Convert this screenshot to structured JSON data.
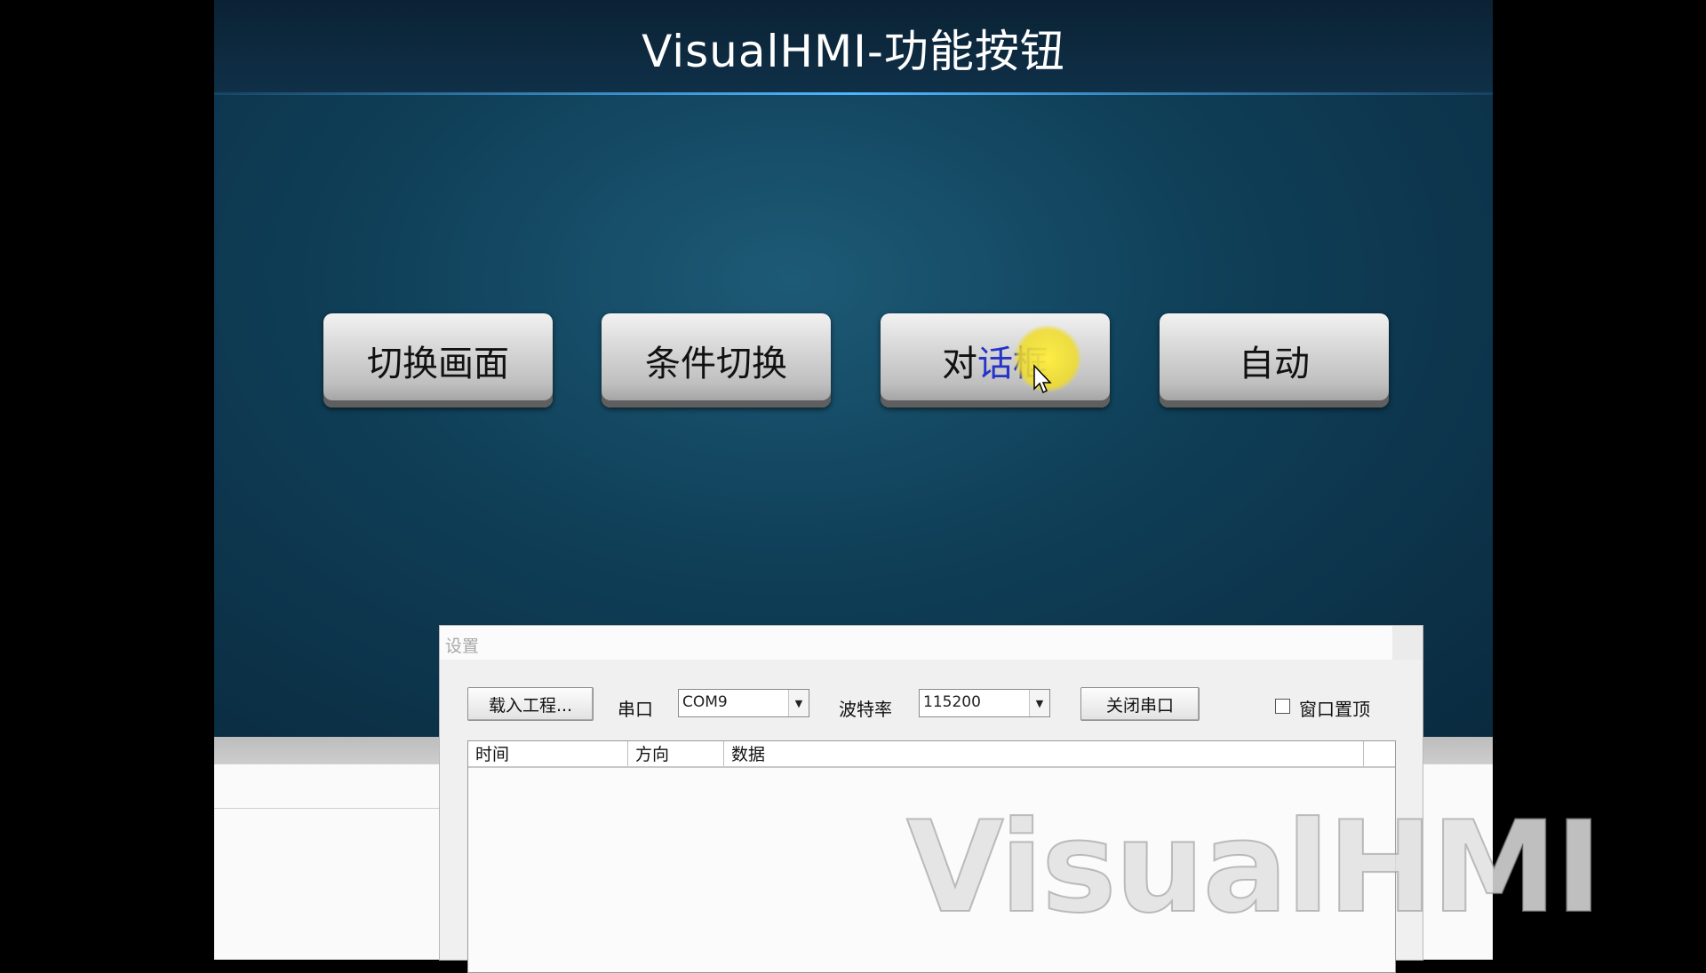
{
  "hmi": {
    "title": "VisualHMI-功能按钮",
    "buttons": [
      "切换画面",
      "条件切换",
      "对话框",
      "自动"
    ]
  },
  "dialog": {
    "title": "设置",
    "load_project": "载入工程...",
    "port_label": "串口",
    "port_value": "COM9",
    "baud_label": "波特率",
    "baud_value": "115200",
    "close_port": "关闭串口",
    "pin_window": "窗口置顶",
    "pin_checked": false,
    "columns": [
      "时间",
      "方向",
      "数据"
    ]
  },
  "watermark": "VisualHMI"
}
